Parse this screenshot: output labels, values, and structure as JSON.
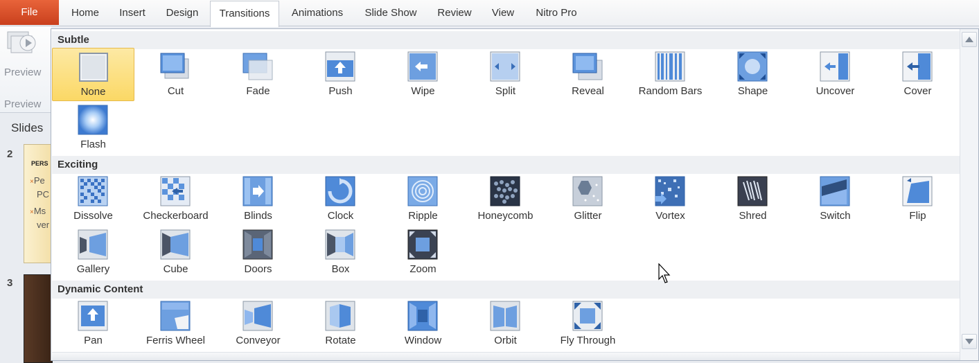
{
  "ribbon": {
    "file_label": "File",
    "tabs": [
      "Home",
      "Insert",
      "Design",
      "Transitions",
      "Animations",
      "Slide Show",
      "Review",
      "View",
      "Nitro Pro"
    ],
    "active_tab": "Transitions"
  },
  "left_panel": {
    "preview_button_label": "Preview",
    "preview_group_label": "Preview",
    "slides_label": "Slides",
    "slide_numbers": [
      "2",
      "3"
    ],
    "slide2_title": "PERS",
    "slide2_lines": [
      "Pe",
      "PC",
      "Ms",
      "ver"
    ]
  },
  "gallery": {
    "sections": [
      {
        "name": "Subtle",
        "items": [
          "None",
          "Cut",
          "Fade",
          "Push",
          "Wipe",
          "Split",
          "Reveal",
          "Random Bars",
          "Shape",
          "Uncover",
          "Cover",
          "Flash"
        ]
      },
      {
        "name": "Exciting",
        "items": [
          "Dissolve",
          "Checkerboard",
          "Blinds",
          "Clock",
          "Ripple",
          "Honeycomb",
          "Glitter",
          "Vortex",
          "Shred",
          "Switch",
          "Flip",
          "Gallery",
          "Cube",
          "Doors",
          "Box",
          "Zoom"
        ]
      },
      {
        "name": "Dynamic Content",
        "items": [
          "Pan",
          "Ferris Wheel",
          "Conveyor",
          "Rotate",
          "Window",
          "Orbit",
          "Fly Through"
        ]
      }
    ],
    "selected_item": "None"
  },
  "colors": {
    "file_tab": "#d4512a",
    "selection": "#fbd865",
    "icon_blue": "#4a86d4"
  }
}
